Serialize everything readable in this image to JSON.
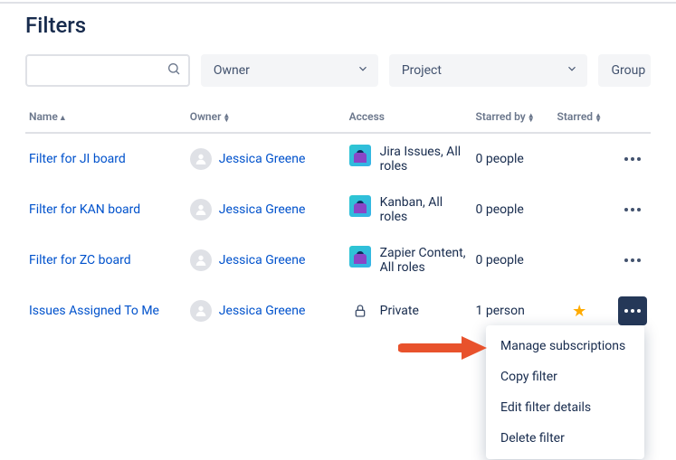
{
  "title": "Filters",
  "controls": {
    "search_placeholder": "",
    "owner_label": "Owner",
    "project_label": "Project",
    "group_label": "Group"
  },
  "columns": {
    "name": "Name",
    "owner": "Owner",
    "access": "Access",
    "starred_by": "Starred by",
    "starred": "Starred"
  },
  "rows": [
    {
      "name": "Filter for JI board",
      "owner": "Jessica Greene",
      "access_icon": "project",
      "access": "Jira Issues, All roles",
      "starred_by": "0 people",
      "starred": false,
      "menu_open": false
    },
    {
      "name": "Filter for KAN board",
      "owner": "Jessica Greene",
      "access_icon": "project",
      "access": "Kanban, All roles",
      "starred_by": "0 people",
      "starred": false,
      "menu_open": false
    },
    {
      "name": "Filter for ZC board",
      "owner": "Jessica Greene",
      "access_icon": "project",
      "access": "Zapier Content, All roles",
      "starred_by": "0 people",
      "starred": false,
      "menu_open": false
    },
    {
      "name": "Issues Assigned To Me",
      "owner": "Jessica Greene",
      "access_icon": "lock",
      "access": "Private",
      "starred_by": "1 person",
      "starred": true,
      "menu_open": true
    }
  ],
  "menu": {
    "manage": "Manage subscriptions",
    "copy": "Copy filter",
    "edit": "Edit filter details",
    "delete": "Delete filter"
  },
  "colors": {
    "link": "#0052CC",
    "accent_arrow": "#E8522C"
  }
}
